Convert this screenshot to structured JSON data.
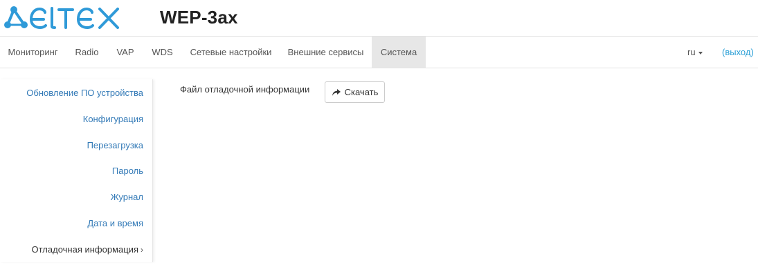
{
  "header": {
    "logo_text": "ELTEX",
    "model": "WEP-3ax",
    "brand_color": "#2f9ad8"
  },
  "nav": {
    "items": [
      "Мониторинг",
      "Radio",
      "VAP",
      "WDS",
      "Сетевые настройки",
      "Внешние сервисы",
      "Система"
    ],
    "active": "Система",
    "language": "ru",
    "logout": "(выход)"
  },
  "sidebar": {
    "items": [
      "Обновление ПО устройства",
      "Конфигурация",
      "Перезагрузка",
      "Пароль",
      "Журнал",
      "Дата и время",
      "Отладочная информация"
    ],
    "active": "Отладочная информация"
  },
  "content": {
    "debug_file_label": "Файл отладочной информации",
    "download_button": "Скачать",
    "download_icon": "share-arrow-icon"
  },
  "colors": {
    "link": "#337ab7",
    "logout_link": "#2a9fd6",
    "active_tab_bg": "#e7e7e7"
  }
}
